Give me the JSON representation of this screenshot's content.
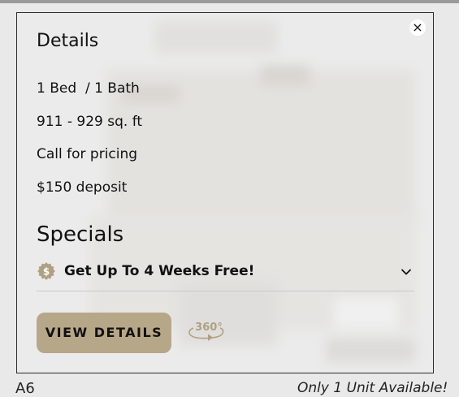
{
  "details": {
    "title": "Details",
    "beds_baths": "1 Bed  / 1 Bath",
    "sqft": "911 - 929 sq. ft",
    "pricing": "Call for pricing",
    "deposit": "$150 deposit"
  },
  "specials": {
    "title": "Specials",
    "item_text": "Get Up To 4 Weeks Free!",
    "badge_icon": "dollar-badge-icon",
    "expand_icon": "chevron-down-icon"
  },
  "actions": {
    "view_details_label": "VIEW DETAILS",
    "tour_360_label": "360°",
    "close_label": "×"
  },
  "footer": {
    "unit_name": "A6",
    "availability": "Only 1 Unit Available!"
  },
  "colors": {
    "accent": "#b7a789",
    "badge": "#b0a082",
    "background": "#e9e9e9",
    "border": "#2b2b2b"
  }
}
